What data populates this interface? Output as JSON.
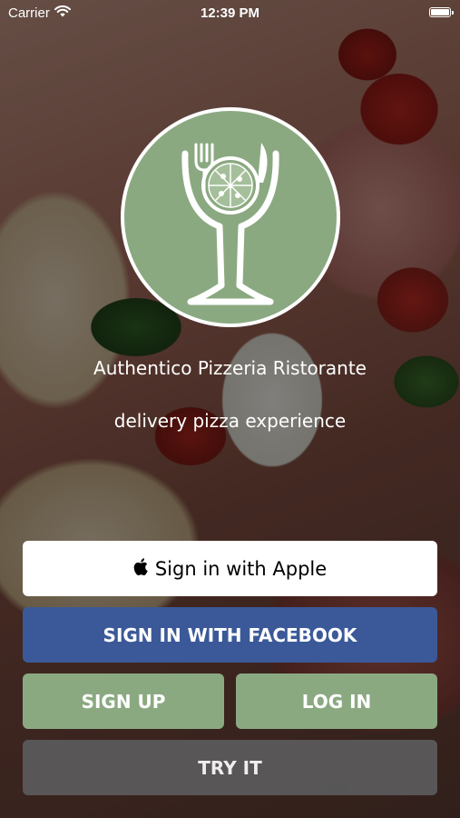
{
  "status_bar": {
    "carrier": "Carrier",
    "time": "12:39 PM",
    "wifi_icon": "wifi-icon",
    "battery_icon": "battery-icon"
  },
  "logo": {
    "icon": "wine-glass-pizza-fork-logo",
    "bg_color": "#8ba981"
  },
  "taglines": {
    "title": "Authentico Pizzeria Ristorante",
    "subtitle": "delivery pizza experience"
  },
  "buttons": {
    "apple": {
      "label": "Sign in with Apple",
      "icon": "apple-icon"
    },
    "facebook": {
      "label": "SIGN IN WITH FACEBOOK",
      "color": "#3b5998"
    },
    "signup": {
      "label": "SIGN UP",
      "color": "#8ba981"
    },
    "login": {
      "label": "LOG IN",
      "color": "#8ba981"
    },
    "try": {
      "label": "TRY IT",
      "color": "#5b5b5b"
    }
  }
}
